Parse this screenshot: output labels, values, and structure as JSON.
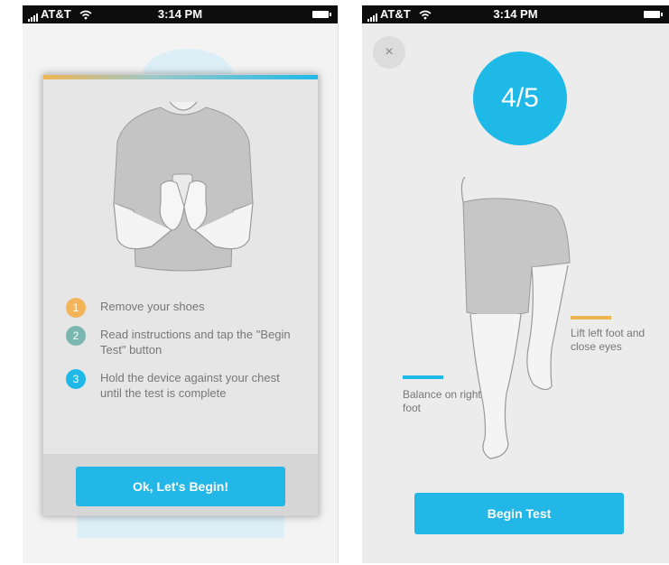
{
  "status_bar": {
    "carrier": "AT&T",
    "time": "3:14 PM"
  },
  "left_screen": {
    "steps": [
      {
        "number": "1",
        "text": "Remove your shoes",
        "color": "#f3b45a"
      },
      {
        "number": "2",
        "text": "Read instructions and tap the \"Begin Test\" button",
        "color": "#7bb7b1"
      },
      {
        "number": "3",
        "text": "Hold the device against your chest until the test is complete",
        "color": "#1fb9e8"
      }
    ],
    "button_label": "Ok, Let's Begin!"
  },
  "right_screen": {
    "close_label": "×",
    "progress": "4/5",
    "label_left": "Balance on right foot",
    "label_right": "Lift left foot and close eyes",
    "button_label": "Begin Test"
  },
  "colors": {
    "accent": "#1fb9e8",
    "orange": "#f0b552",
    "teal": "#7bb7b1"
  }
}
